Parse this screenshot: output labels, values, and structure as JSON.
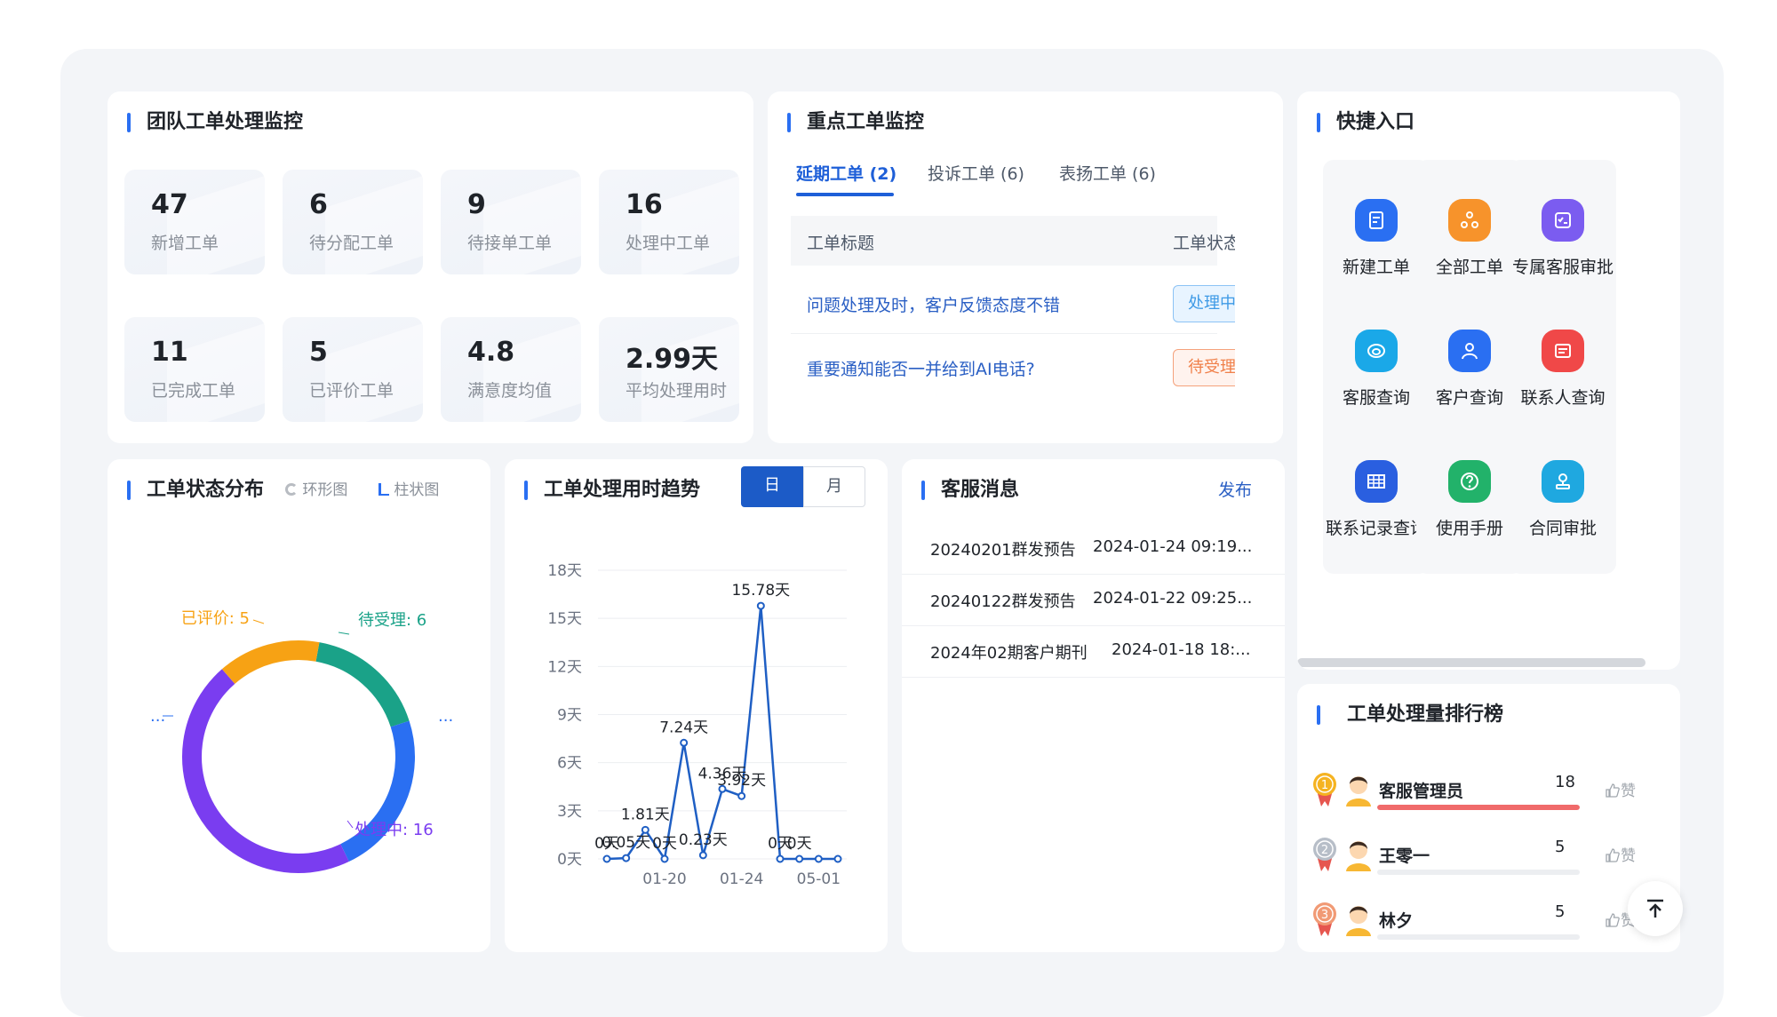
{
  "team": {
    "title": "团队工单处理监控",
    "stats": [
      {
        "value": "47",
        "label": "新增工单"
      },
      {
        "value": "6",
        "label": "待分配工单"
      },
      {
        "value": "9",
        "label": "待接单工单"
      },
      {
        "value": "16",
        "label": "处理中工单"
      },
      {
        "value": "11",
        "label": "已完成工单"
      },
      {
        "value": "5",
        "label": "已评价工单"
      },
      {
        "value": "4.8",
        "label": "满意度均值"
      },
      {
        "value": "2.99天",
        "label": "平均处理用时"
      }
    ]
  },
  "key": {
    "title": "重点工单监控",
    "tabs": [
      "延期工单 (2)",
      "投诉工单 (6)",
      "表扬工单 (6)"
    ],
    "col_title": "工单标题",
    "col_status": "工单状态",
    "rows": [
      {
        "title": "问题处理及时，客户反馈态度不错",
        "status": "处理中"
      },
      {
        "title": "重要通知能否一并给到AI电话?",
        "status": "待受理"
      }
    ]
  },
  "quick": {
    "title": "快捷入口",
    "items": [
      {
        "label": "新建工单",
        "color": "#2a6ff2",
        "icon": "edit-doc-icon"
      },
      {
        "label": "全部工单",
        "color": "#f7932b",
        "icon": "nodes-icon"
      },
      {
        "label": "专属客服审批",
        "color": "#7b5cf0",
        "icon": "checklist-icon"
      },
      {
        "label": "客服查询",
        "color": "#1aa8e8",
        "icon": "service-icon"
      },
      {
        "label": "客户查询",
        "color": "#2a6ff2",
        "icon": "user-icon"
      },
      {
        "label": "联系人查询",
        "color": "#f04848",
        "icon": "card-icon"
      },
      {
        "label": "联系记录查询",
        "color": "#2a5fe0",
        "icon": "grid-icon"
      },
      {
        "label": "使用手册",
        "color": "#22b26a",
        "icon": "help-icon"
      },
      {
        "label": "合同审批",
        "color": "#1fa8e0",
        "icon": "stamp-icon"
      }
    ]
  },
  "dist": {
    "title": "工单状态分布",
    "switch_ring": "环形图",
    "switch_bar": "柱状图",
    "ellipsis": "..."
  },
  "trend": {
    "title": "工单处理用时趋势",
    "seg_day": "日",
    "seg_month": "月"
  },
  "messages": {
    "title": "客服消息",
    "publish": "发布",
    "items": [
      {
        "title": "20240201群发预告",
        "time": "2024-01-24 09:19..."
      },
      {
        "title": "20240122群发预告",
        "time": "2024-01-22 09:25..."
      },
      {
        "title": "2024年02期客户期刊",
        "time": "2024-01-18 18:..."
      }
    ]
  },
  "ranking": {
    "title": "工单处理量排行榜",
    "like": "赞",
    "items": [
      {
        "rank": "1",
        "name": "客服管理员",
        "count": 18,
        "fill": 1.0
      },
      {
        "rank": "2",
        "name": "王零一",
        "count": 5,
        "fill": 0
      },
      {
        "rank": "3",
        "name": "林夕",
        "count": 5,
        "fill": 0
      }
    ]
  },
  "chart_data": [
    {
      "type": "pie",
      "categories": [
        "待受理",
        "处理中",
        "已评价",
        "..."
      ],
      "values": [
        6,
        16,
        5,
        8
      ],
      "labels_shown": [
        "待受理: 6",
        "处理中: 16",
        "已评价: 5",
        "..."
      ],
      "colors": [
        "#1aa288",
        "#7a3df0",
        "#f7a214",
        "#2a6ff2"
      ],
      "legend": "none"
    },
    {
      "type": "line",
      "x": [
        "",
        "",
        "",
        "01-20",
        "",
        "",
        "",
        "01-24",
        "",
        "",
        "",
        "05-01",
        ""
      ],
      "values": [
        0,
        0.05,
        1.81,
        0,
        7.24,
        0.23,
        4.36,
        3.92,
        15.78,
        0,
        0,
        0,
        0
      ],
      "point_labels": [
        "0天",
        "0.05天",
        "1.81天",
        "0天",
        "7.24天",
        "0.23天",
        "4.36天",
        "3.92天",
        "15.78天",
        "0天",
        "0天",
        "",
        ""
      ],
      "yticks": [
        "0天",
        "3天",
        "6天",
        "9天",
        "12天",
        "15天",
        "18天"
      ],
      "ylim": [
        0,
        18
      ],
      "grid": true,
      "color": "#1f5fc4"
    }
  ]
}
